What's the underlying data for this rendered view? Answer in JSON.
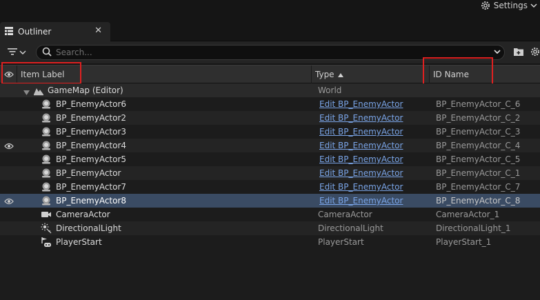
{
  "topbar": {
    "settings_label": "Settings",
    "settings_icon": "gear-icon",
    "settings_dropdown_icon": "chevron-down-icon"
  },
  "tab": {
    "label": "Outliner",
    "icon": "outliner-icon",
    "close_symbol": "✕"
  },
  "toolbar": {
    "filter_icon": "filter-icon",
    "search_placeholder": "Search...",
    "search_value": "",
    "add_folder_icon": "add-folder-icon",
    "settings_icon": "gear-icon"
  },
  "columns": {
    "visibility_icon": "eye-icon",
    "item_label": "Item Label",
    "type": "Type",
    "type_sort": "ascending",
    "id_name": "ID Name"
  },
  "highlight_color": "#e02020",
  "selected_color": "#3a4b63",
  "link_color": "#7aa5e8",
  "world": {
    "label": "GameMap (Editor)",
    "type": "World",
    "expanded": true
  },
  "rows": [
    {
      "label": "BP_EnemyActor6",
      "type": "Edit BP_EnemyActor",
      "id": "BP_EnemyActor_C_6",
      "icon": "pawn-actor-icon",
      "visible_eye": false,
      "selected": false,
      "link": true
    },
    {
      "label": "BP_EnemyActor2",
      "type": "Edit BP_EnemyActor",
      "id": "BP_EnemyActor_C_2",
      "icon": "pawn-actor-icon",
      "visible_eye": false,
      "selected": false,
      "link": true
    },
    {
      "label": "BP_EnemyActor3",
      "type": "Edit BP_EnemyActor",
      "id": "BP_EnemyActor_C_3",
      "icon": "pawn-actor-icon",
      "visible_eye": false,
      "selected": false,
      "link": true
    },
    {
      "label": "BP_EnemyActor4",
      "type": "Edit BP_EnemyActor",
      "id": "BP_EnemyActor_C_4",
      "icon": "pawn-actor-icon",
      "visible_eye": true,
      "selected": false,
      "link": true
    },
    {
      "label": "BP_EnemyActor5",
      "type": "Edit BP_EnemyActor",
      "id": "BP_EnemyActor_C_5",
      "icon": "pawn-actor-icon",
      "visible_eye": false,
      "selected": false,
      "link": true
    },
    {
      "label": "BP_EnemyActor",
      "type": "Edit BP_EnemyActor",
      "id": "BP_EnemyActor_C_1",
      "icon": "pawn-actor-icon",
      "visible_eye": false,
      "selected": false,
      "link": true
    },
    {
      "label": "BP_EnemyActor7",
      "type": "Edit BP_EnemyActor",
      "id": "BP_EnemyActor_C_7",
      "icon": "pawn-actor-icon",
      "visible_eye": false,
      "selected": false,
      "link": true
    },
    {
      "label": "BP_EnemyActor8",
      "type": "Edit BP_EnemyActor",
      "id": "BP_EnemyActor_C_8",
      "icon": "pawn-actor-icon",
      "visible_eye": true,
      "selected": true,
      "link": true
    },
    {
      "label": "CameraActor",
      "type": "CameraActor",
      "id": "CameraActor_1",
      "icon": "camera-icon",
      "visible_eye": false,
      "selected": false,
      "link": false
    },
    {
      "label": "DirectionalLight",
      "type": "DirectionalLight",
      "id": "DirectionalLight_1",
      "icon": "directional-light-icon",
      "visible_eye": false,
      "selected": false,
      "link": false
    },
    {
      "label": "PlayerStart",
      "type": "PlayerStart",
      "id": "PlayerStart_1",
      "icon": "player-start-icon",
      "visible_eye": false,
      "selected": false,
      "link": false
    }
  ]
}
